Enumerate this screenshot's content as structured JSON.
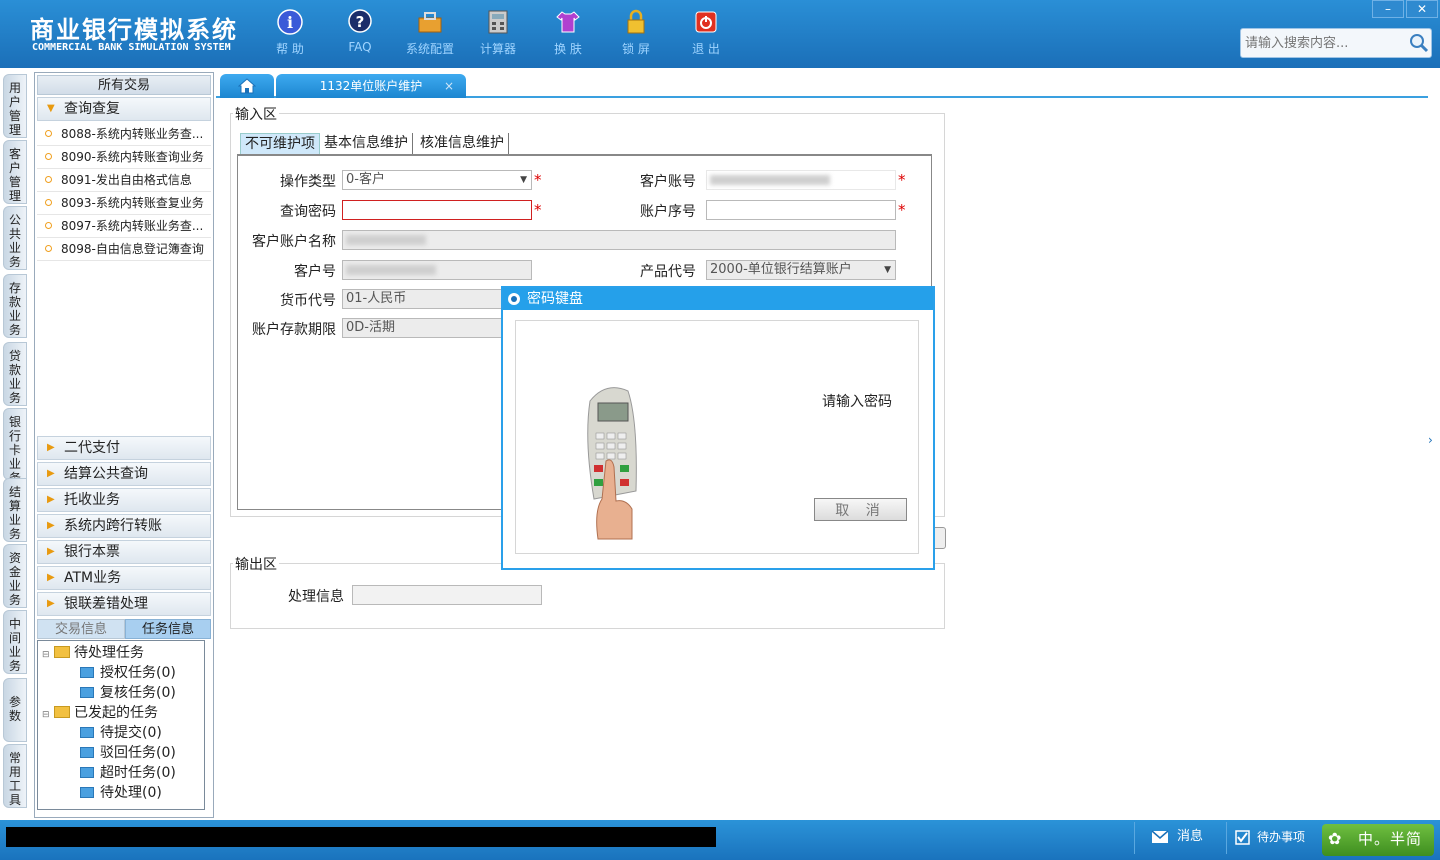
{
  "header": {
    "title": "商业银行模拟系统",
    "subtitle": "COMMERCIAL BANK SIMULATION SYSTEM",
    "toolbar": [
      {
        "label": "帮 助",
        "icon": "info-icon"
      },
      {
        "label": "FAQ",
        "icon": "faq-icon"
      },
      {
        "label": "系统配置",
        "icon": "toolbox-icon"
      },
      {
        "label": "计算器",
        "icon": "calculator-icon"
      },
      {
        "label": "换 肤",
        "icon": "shirt-icon"
      },
      {
        "label": "锁 屏",
        "icon": "lock-icon"
      },
      {
        "label": "退 出",
        "icon": "power-icon"
      }
    ],
    "window": {
      "minimize": "–",
      "close": "✕"
    },
    "search_placeholder": "请输入搜索内容..."
  },
  "left_strip": [
    "用户管理",
    "客户管理",
    "公共业务",
    "存款业务",
    "贷款业务",
    "银行卡业务",
    "结算业务",
    "资金业务",
    "中间业务",
    "参数",
    "常用工具"
  ],
  "sidebar": {
    "header": "所有交易",
    "open_group": "查询查复",
    "items": [
      "8088-系统内转账业务查...",
      "8090-系统内转账查询业务",
      "8091-发出自由格式信息",
      "8093-系统内转账查复业务",
      "8097-系统内转账业务查...",
      "8098-自由信息登记簿查询"
    ],
    "groups": [
      "二代支付",
      "结算公共查询",
      "托收业务",
      "系统内跨行转账",
      "银行本票",
      "ATM业务",
      "银联差错处理"
    ],
    "bottom_tabs": [
      "交易信息",
      "任务信息"
    ],
    "tree": {
      "pending": "待处理任务",
      "auth": "授权任务(0)",
      "review": "复核任务(0)",
      "initiated": "已发起的任务",
      "to_submit": "待提交(0)",
      "rejected": "驳回任务(0)",
      "timeout": "超时任务(0)",
      "to_process": "待处理(0)"
    }
  },
  "tabs": {
    "home_icon": "home-icon",
    "active": "1132单位账户维护",
    "close": "×"
  },
  "input_area": {
    "legend": "输入区",
    "form_tabs": [
      "不可维护项",
      "基本信息维护",
      "核准信息维护"
    ],
    "fields": {
      "op_type_label": "操作类型",
      "op_type_value": "0-客户",
      "acct_no_label": "客户账号",
      "query_pwd_label": "查询密码",
      "acct_seq_label": "账户序号",
      "acct_name_label": "客户账户名称",
      "cust_no_label": "客户号",
      "product_label": "产品代号",
      "product_value": "2000-单位银行结算账户",
      "currency_label": "货币代号",
      "currency_value": "01-人民币",
      "term_label": "账户存款期限",
      "term_value": "0D-活期"
    },
    "required_mark": "*"
  },
  "output_area": {
    "legend": "输出区",
    "info_label": "处理信息"
  },
  "dialog": {
    "title": "密码键盘",
    "prompt": "请输入密码",
    "cancel": "取 消"
  },
  "footer": {
    "message": "消息",
    "todo": "待办事项",
    "ime": "中。半简"
  },
  "colors": {
    "header": "#1f7ec7",
    "tab": "#2596df",
    "required": "#dd0000",
    "accent_arrow": "#e89a10"
  }
}
